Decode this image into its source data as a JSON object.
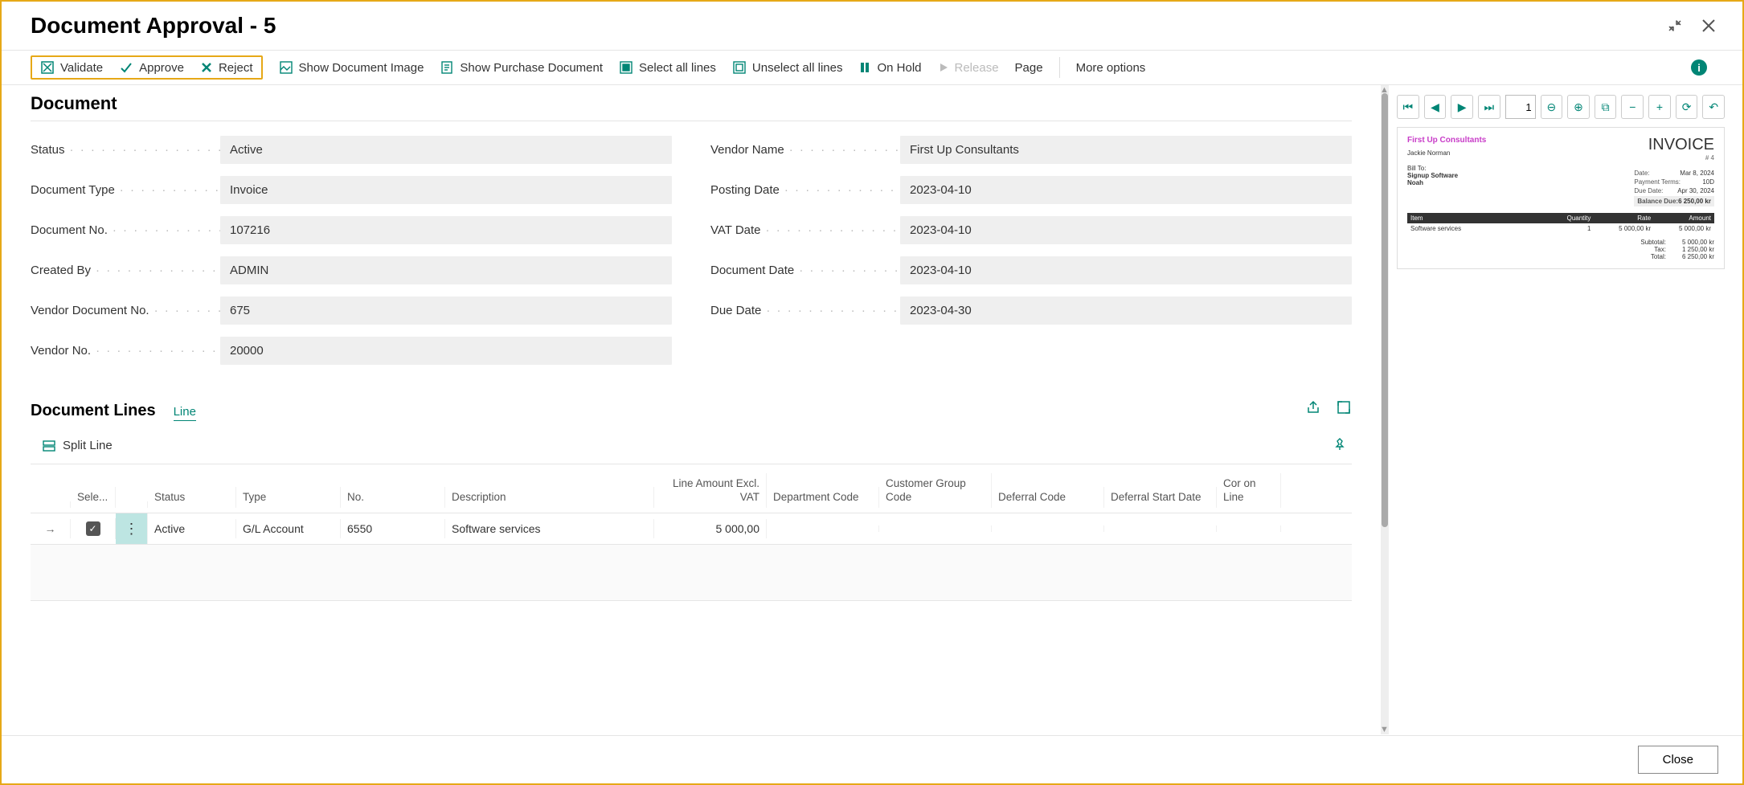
{
  "page_title": "Document Approval - 5",
  "toolbar": {
    "validate": "Validate",
    "approve": "Approve",
    "reject": "Reject",
    "show_doc_image": "Show Document Image",
    "show_purchase_doc": "Show Purchase Document",
    "select_all": "Select all lines",
    "unselect_all": "Unselect all lines",
    "on_hold": "On Hold",
    "release": "Release",
    "page": "Page",
    "more_options": "More options"
  },
  "document_section_title": "Document",
  "fields_left": [
    {
      "label": "Status",
      "value": "Active"
    },
    {
      "label": "Document Type",
      "value": "Invoice"
    },
    {
      "label": "Document No.",
      "value": "107216"
    },
    {
      "label": "Created By",
      "value": "ADMIN"
    },
    {
      "label": "Vendor Document No.",
      "value": "675"
    },
    {
      "label": "Vendor No.",
      "value": "20000"
    }
  ],
  "fields_right": [
    {
      "label": "Vendor Name",
      "value": "First Up Consultants"
    },
    {
      "label": "Posting Date",
      "value": "2023-04-10"
    },
    {
      "label": "VAT Date",
      "value": "2023-04-10"
    },
    {
      "label": "Document Date",
      "value": "2023-04-10"
    },
    {
      "label": "Due Date",
      "value": "2023-04-30"
    }
  ],
  "lines": {
    "title": "Document Lines",
    "tab": "Line",
    "split_line": "Split Line",
    "columns": {
      "sele": "Sele...",
      "status": "Status",
      "type": "Type",
      "no": "No.",
      "desc": "Description",
      "amount": "Line Amount Excl. VAT",
      "dept": "Department Code",
      "cust": "Customer Group Code",
      "deferral": "Deferral Code",
      "defstart": "Deferral Start Date",
      "cor": "Cor on Line"
    },
    "rows": [
      {
        "checked": true,
        "status": "Active",
        "type": "G/L Account",
        "no": "6550",
        "desc": "Software services",
        "amount": "5 000,00",
        "dept": "",
        "cust": "",
        "deferral": "",
        "defstart": "",
        "cor": ""
      }
    ]
  },
  "preview": {
    "page_input": "1",
    "vendor": "First Up Consultants",
    "title": "INVOICE",
    "title_sub": "# 4",
    "contact": "Jackie Norman",
    "bill_to_label": "Bill To:",
    "bill_to": "Signup Software\nNoah",
    "meta": [
      {
        "l": "Date:",
        "r": "Mar 8, 2024"
      },
      {
        "l": "Payment Terms:",
        "r": "10D"
      },
      {
        "l": "Due Date:",
        "r": "Apr 30, 2024"
      },
      {
        "l": "Balance Due:",
        "r": "6 250,00 kr"
      }
    ],
    "table_head": [
      "Item",
      "Quantity",
      "Rate",
      "Amount"
    ],
    "table_row": [
      "Software services",
      "1",
      "5 000,00 kr",
      "5 000,00 kr"
    ],
    "totals": [
      {
        "l": "Subtotal:",
        "r": "5 000,00 kr"
      },
      {
        "l": "Tax:",
        "r": "1 250,00 kr"
      },
      {
        "l": "Total:",
        "r": "6 250,00 kr"
      }
    ]
  },
  "footer_close": "Close"
}
